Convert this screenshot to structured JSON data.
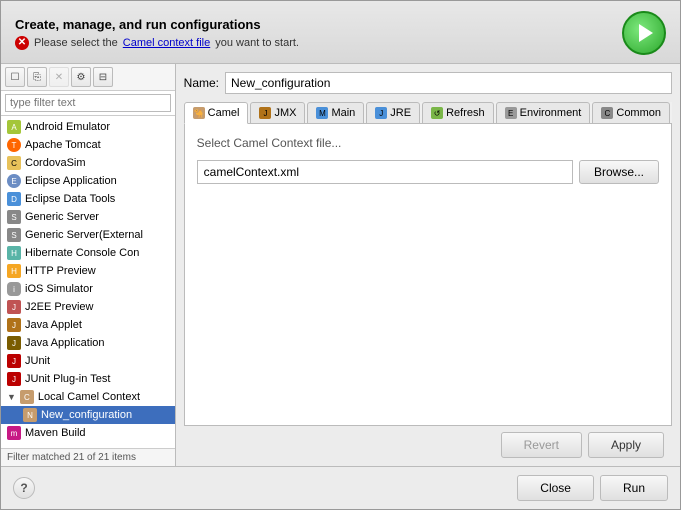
{
  "dialog": {
    "title": "Create, manage, and run configurations",
    "error_message_prefix": "Please select the ",
    "error_message_link": "Camel context file",
    "error_message_suffix": " you want to start."
  },
  "toolbar": {
    "buttons": [
      "new",
      "duplicate",
      "delete",
      "filter",
      "collapse"
    ]
  },
  "filter": {
    "placeholder": "type filter text"
  },
  "tree": {
    "items": [
      {
        "id": "android",
        "label": "Android Emulator",
        "icon": "android",
        "level": 0
      },
      {
        "id": "tomcat",
        "label": "Apache Tomcat",
        "icon": "tomcat",
        "level": 0
      },
      {
        "id": "cordova",
        "label": "CordovaSim",
        "icon": "cordova",
        "level": 0
      },
      {
        "id": "eclipse-app",
        "label": "Eclipse Application",
        "icon": "eclipse",
        "level": 0
      },
      {
        "id": "eclipse-data",
        "label": "Eclipse Data Tools",
        "icon": "data",
        "level": 0
      },
      {
        "id": "generic",
        "label": "Generic Server",
        "icon": "server",
        "level": 0
      },
      {
        "id": "generic-ext",
        "label": "Generic Server(External",
        "icon": "server",
        "level": 0
      },
      {
        "id": "hibernate",
        "label": "Hibernate Console Con",
        "icon": "hibernate",
        "level": 0
      },
      {
        "id": "http",
        "label": "HTTP Preview",
        "icon": "http",
        "level": 0
      },
      {
        "id": "ios",
        "label": "iOS Simulator",
        "icon": "ios",
        "level": 0
      },
      {
        "id": "j2ee",
        "label": "J2EE Preview",
        "icon": "j2ee",
        "level": 0
      },
      {
        "id": "java-applet",
        "label": "Java Applet",
        "icon": "java",
        "level": 0
      },
      {
        "id": "java-app",
        "label": "Java Application",
        "icon": "javaapp",
        "level": 0
      },
      {
        "id": "junit",
        "label": "JUnit",
        "icon": "junit",
        "level": 0
      },
      {
        "id": "junit-plugin",
        "label": "JUnit Plug-in Test",
        "icon": "junit",
        "level": 0
      },
      {
        "id": "local-camel",
        "label": "Local Camel Context",
        "icon": "camel",
        "level": 0,
        "expanded": true
      },
      {
        "id": "new-config",
        "label": "New_configuration",
        "icon": "newconfig",
        "level": 1,
        "selected": true
      },
      {
        "id": "maven",
        "label": "Maven Build",
        "icon": "maven",
        "level": 0
      }
    ],
    "filter_status": "Filter matched 21 of 21 items"
  },
  "name_field": {
    "label": "Name:",
    "value": "New_configuration"
  },
  "tabs": [
    {
      "id": "camel",
      "label": "Camel",
      "icon_color": "#c69c6d"
    },
    {
      "id": "jmx",
      "label": "JMX",
      "icon_color": "#b07219"
    },
    {
      "id": "main",
      "label": "Main",
      "icon_color": "#4a90d9"
    },
    {
      "id": "jre",
      "label": "JRE",
      "icon_color": "#4a90d9"
    },
    {
      "id": "refresh",
      "label": "Refresh",
      "icon_color": "#7ab648"
    },
    {
      "id": "environment",
      "label": "Environment",
      "icon_color": "#999"
    },
    {
      "id": "common",
      "label": "Common",
      "icon_color": "#888"
    }
  ],
  "active_tab": "camel",
  "camel_content": {
    "label": "Select Camel Context file...",
    "file_value": "camelContext.xml",
    "browse_label": "Browse..."
  },
  "buttons": {
    "revert": "Revert",
    "apply": "Apply",
    "close": "Close",
    "run": "Run"
  }
}
